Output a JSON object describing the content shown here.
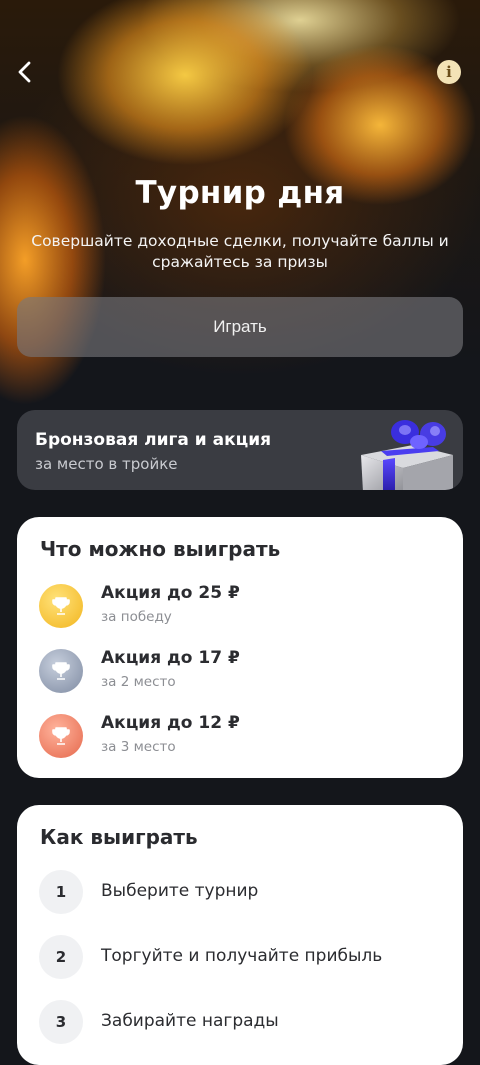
{
  "header": {
    "back_icon": "chevron-left-icon",
    "info_icon": "info-icon",
    "info_glyph": "i",
    "title": "Турнир дня",
    "subtitle": "Совершайте доходные сделки, получайте баллы и сражайтесь за призы"
  },
  "play_button": {
    "label": "Играть"
  },
  "league_banner": {
    "title": "Бронзовая лига и акция",
    "subtitle": "за место в тройке",
    "image": "gift-box-image"
  },
  "prizes": {
    "title": "Что можно выиграть",
    "items": [
      {
        "title": "Акция до 25 ₽",
        "subtitle": "за победу",
        "icon": "gold-trophy-icon",
        "color": "#f2c230"
      },
      {
        "title": "Акция до 17 ₽",
        "subtitle": "за 2 место",
        "icon": "silver-trophy-icon",
        "color": "#8e9bb3"
      },
      {
        "title": "Акция до 12 ₽",
        "subtitle": "за 3 место",
        "icon": "bronze-trophy-icon",
        "color": "#ef8b70"
      }
    ]
  },
  "how_to_win": {
    "title": "Как выиграть",
    "steps": [
      {
        "number": "1",
        "text": "Выберите турнир"
      },
      {
        "number": "2",
        "text": "Торгуйте и получайте прибыль"
      },
      {
        "number": "3",
        "text": "Забирайте награды"
      }
    ]
  }
}
